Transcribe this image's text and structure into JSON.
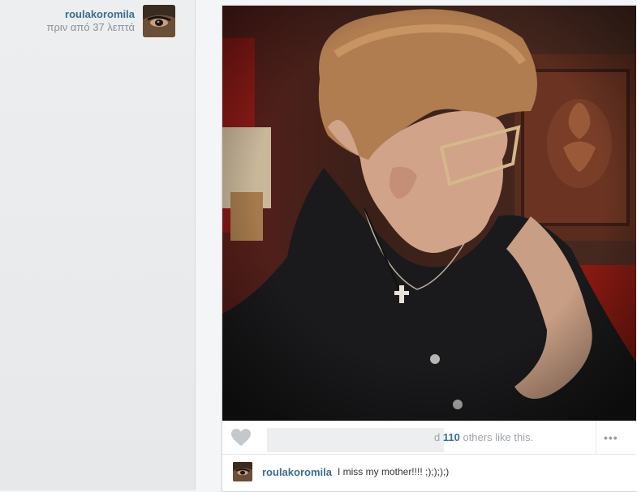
{
  "author": {
    "username": "roulakoromila",
    "time_ago": "πριν από 37 λεπτά"
  },
  "post": {
    "likes": {
      "count": "110",
      "prefix": "d",
      "suffix": "others like this."
    },
    "more_label": "•••",
    "comment": {
      "username": "roulakoromila",
      "text": "I miss my mother!!!! ;);););)"
    }
  },
  "icons": {
    "like": "heart-icon",
    "more": "more-options-icon"
  },
  "colors": {
    "link": "#3e6d8e",
    "muted": "#a0a5aa",
    "heart": "#c5c8cb"
  }
}
